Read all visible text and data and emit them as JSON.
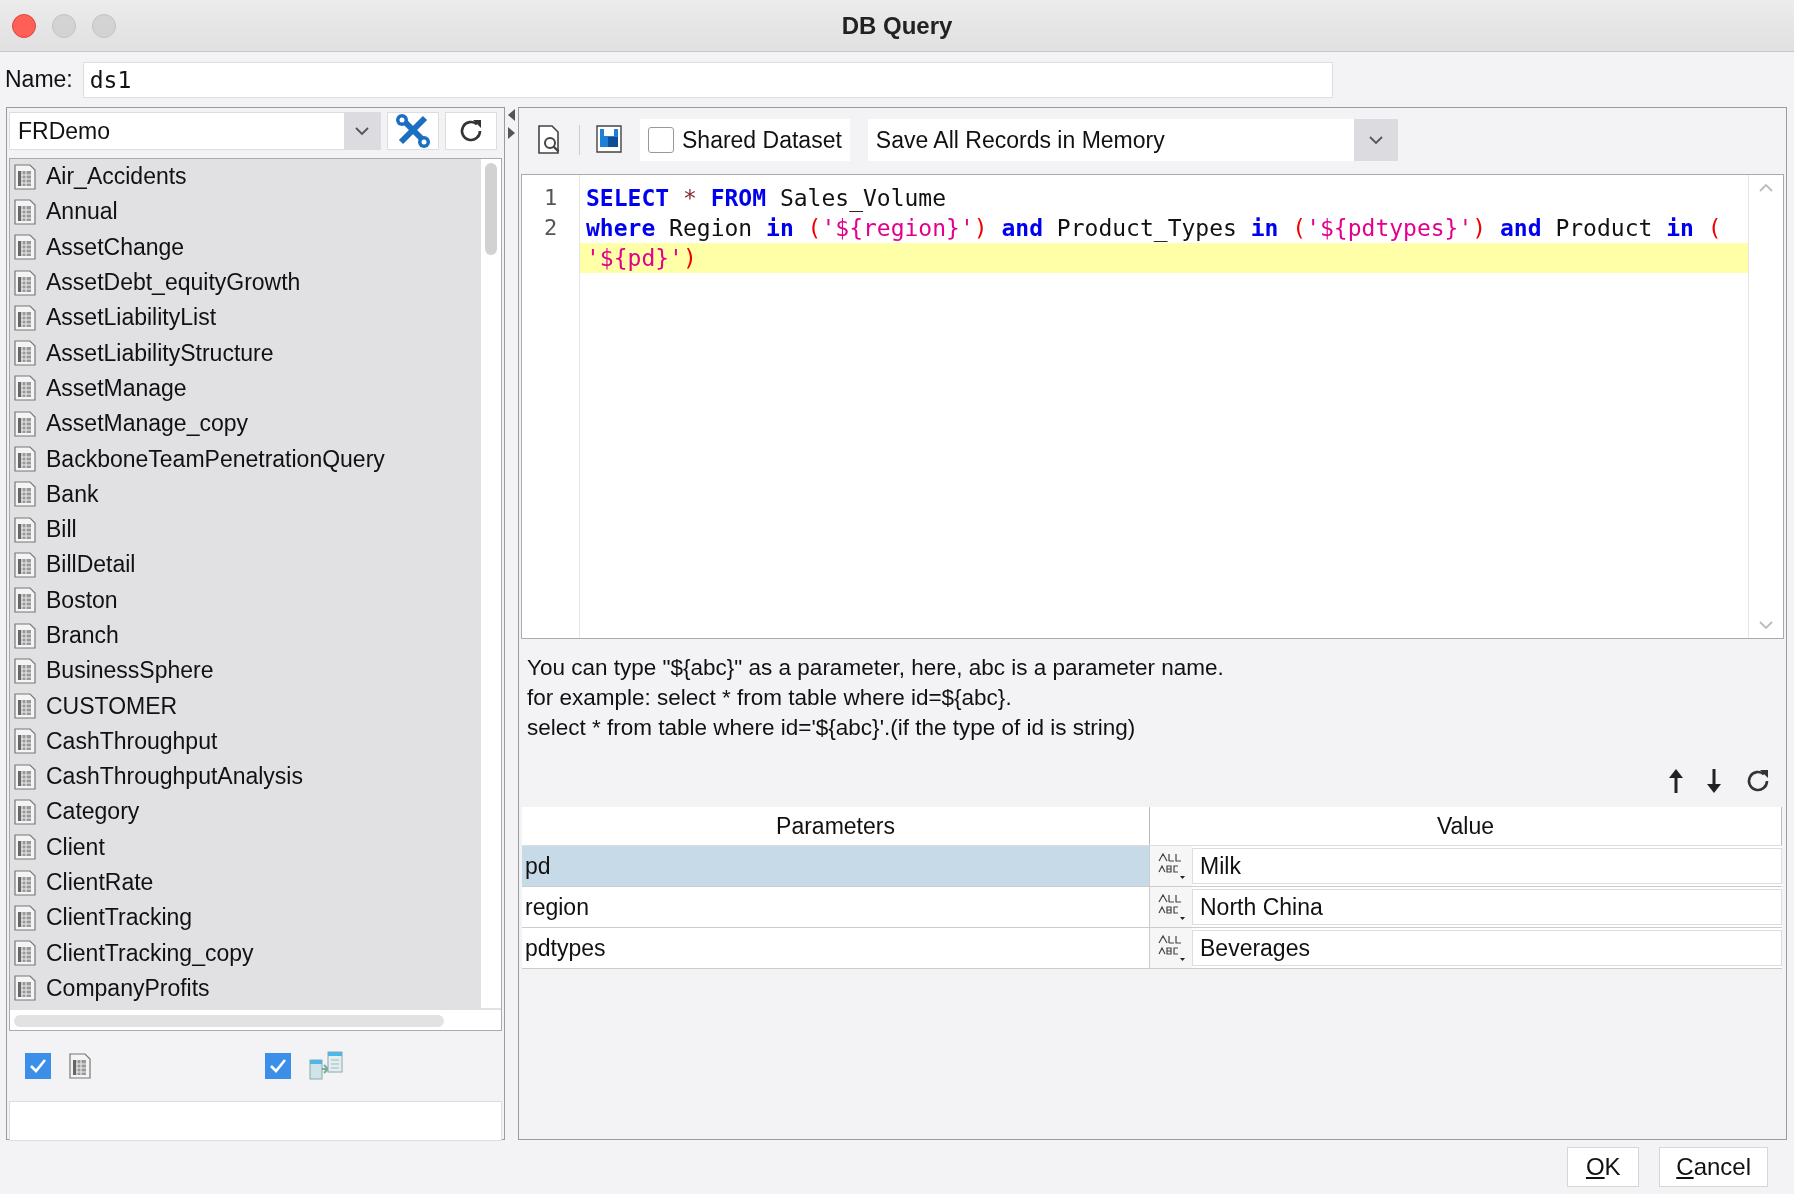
{
  "window": {
    "title": "DB Query"
  },
  "name_field": {
    "label": "Name:",
    "value": "ds1"
  },
  "datasource": {
    "value": "FRDemo"
  },
  "tables": [
    "Air_Accidents",
    "Annual",
    "AssetChange",
    "AssetDebt_equityGrowth",
    "AssetLiabilityList",
    "AssetLiabilityStructure",
    "AssetManage",
    "AssetManage_copy",
    "BackboneTeamPenetrationQuery",
    "Bank",
    "Bill",
    "BillDetail",
    "Boston",
    "Branch",
    "BusinessSphere",
    "CUSTOMER",
    "CashThroughput",
    "CashThroughputAnalysis",
    "Category",
    "Client",
    "ClientRate",
    "ClientTracking",
    "ClientTracking_copy",
    "CompanyProfits"
  ],
  "filters": [
    {
      "checked": true
    },
    {
      "checked": true
    }
  ],
  "toolbar": {
    "shared_dataset": {
      "label": "Shared Dataset",
      "checked": false
    },
    "memory_mode": {
      "value": "Save All Records in Memory"
    }
  },
  "editor": {
    "lines": [
      {
        "number": "1",
        "highlighted": false,
        "tokens": [
          {
            "kind": "keyword",
            "text": "SELECT "
          },
          {
            "kind": "operator",
            "text": "* "
          },
          {
            "kind": "keyword",
            "text": "FROM "
          },
          {
            "kind": "plain",
            "text": "Sales_Volume"
          }
        ]
      },
      {
        "number": "2",
        "highlighted": false,
        "tokens": [
          {
            "kind": "keyword",
            "text": "where "
          },
          {
            "kind": "plain",
            "text": "Region "
          },
          {
            "kind": "keyword",
            "text": "in "
          },
          {
            "kind": "paren",
            "text": "("
          },
          {
            "kind": "string",
            "text": "'${region}'"
          },
          {
            "kind": "paren",
            "text": ") "
          },
          {
            "kind": "keyword",
            "text": "and "
          },
          {
            "kind": "plain",
            "text": "Product_Types "
          },
          {
            "kind": "keyword",
            "text": "in "
          },
          {
            "kind": "paren",
            "text": "("
          },
          {
            "kind": "string",
            "text": "'${pdtypes}'"
          },
          {
            "kind": "paren",
            "text": ") "
          },
          {
            "kind": "keyword",
            "text": "and "
          },
          {
            "kind": "plain",
            "text": "Product "
          },
          {
            "kind": "keyword",
            "text": "in "
          },
          {
            "kind": "paren",
            "text": "("
          }
        ]
      },
      {
        "highlighted": true,
        "tokens": [
          {
            "kind": "string",
            "text": "'${pd}'"
          },
          {
            "kind": "paren",
            "text": ")"
          }
        ]
      }
    ]
  },
  "help_text": [
    "You can type \"${abc}\" as a parameter, here, abc is a parameter name.",
    "for example: select * from table where id=${abc}.",
    "select * from table where id='${abc}'.(if the type of id is string)"
  ],
  "parameters": {
    "columns": [
      "Parameters",
      "Value"
    ],
    "rows": [
      {
        "name": "pd",
        "value": "Milk",
        "selected": true
      },
      {
        "name": "region",
        "value": "North China",
        "selected": false
      },
      {
        "name": "pdtypes",
        "value": "Beverages",
        "selected": false
      }
    ]
  },
  "buttons": [
    {
      "label": "OK"
    },
    {
      "label": "Cancel"
    }
  ]
}
